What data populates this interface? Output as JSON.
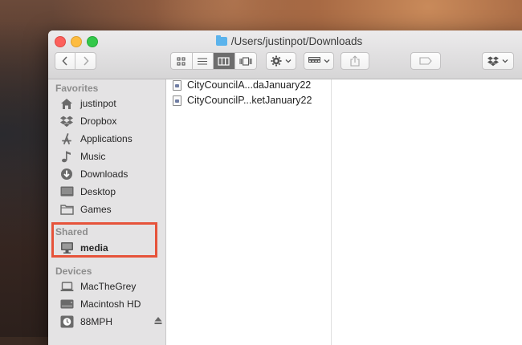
{
  "window": {
    "title": "/Users/justinpot/Downloads"
  },
  "toolbar": {
    "back_icon": "chevron-left-icon",
    "forward_icon": "chevron-right-icon",
    "view_modes": [
      "icon-view",
      "list-view",
      "column-view",
      "cover-flow-view"
    ],
    "active_view": "column-view"
  },
  "sidebar": {
    "favorites": {
      "title": "Favorites",
      "items": [
        {
          "label": "justinpot",
          "icon": "home-icon"
        },
        {
          "label": "Dropbox",
          "icon": "dropbox-icon"
        },
        {
          "label": "Applications",
          "icon": "applications-icon"
        },
        {
          "label": "Music",
          "icon": "music-icon"
        },
        {
          "label": "Downloads",
          "icon": "downloads-icon"
        },
        {
          "label": "Desktop",
          "icon": "desktop-icon"
        },
        {
          "label": "Games",
          "icon": "folder-icon"
        }
      ]
    },
    "shared": {
      "title": "Shared",
      "items": [
        {
          "label": "media",
          "icon": "network-computer-icon"
        }
      ]
    },
    "devices": {
      "title": "Devices",
      "items": [
        {
          "label": "MacTheGrey",
          "icon": "laptop-icon"
        },
        {
          "label": "Macintosh HD",
          "icon": "hard-drive-icon"
        },
        {
          "label": "88MPH",
          "icon": "time-machine-drive-icon"
        }
      ]
    }
  },
  "files": [
    {
      "name": "CityCouncilA...daJanuary22"
    },
    {
      "name": "CityCouncilP...ketJanuary22"
    }
  ],
  "colors": {
    "highlight": "#e6533a",
    "accent": "#5bb3ec"
  }
}
